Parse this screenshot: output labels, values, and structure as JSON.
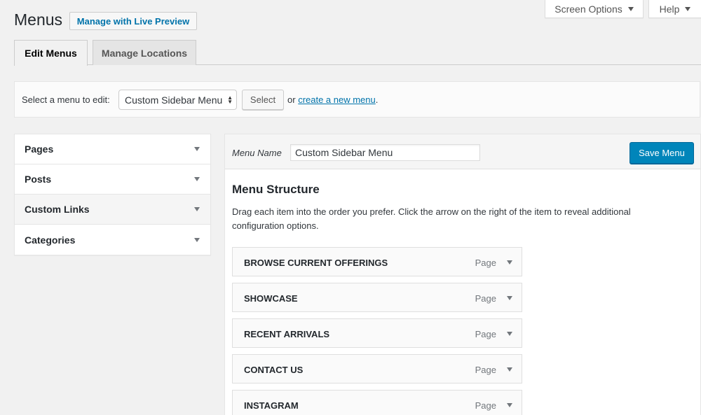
{
  "screen_meta": {
    "screen_options": "Screen Options",
    "help": "Help"
  },
  "header": {
    "title": "Menus",
    "live_preview": "Manage with Live Preview"
  },
  "tabs": [
    {
      "label": "Edit Menus",
      "active": true
    },
    {
      "label": "Manage Locations",
      "active": false
    }
  ],
  "menu_select": {
    "label": "Select a menu to edit:",
    "selected": "Custom Sidebar Menu",
    "select_button": "Select",
    "or_text": "or",
    "create_link": "create a new menu",
    "period": "."
  },
  "accordion": [
    {
      "label": "Pages"
    },
    {
      "label": "Posts"
    },
    {
      "label": "Custom Links"
    },
    {
      "label": "Categories"
    }
  ],
  "menu_editor": {
    "name_label": "Menu Name",
    "name_value": "Custom Sidebar Menu",
    "save_button": "Save Menu",
    "structure_title": "Menu Structure",
    "structure_desc": "Drag each item into the order you prefer. Click the arrow on the right of the item to reveal additional configuration options."
  },
  "menu_items": [
    {
      "title": "BROWSE CURRENT OFFERINGS",
      "type": "Page"
    },
    {
      "title": "SHOWCASE",
      "type": "Page"
    },
    {
      "title": "RECENT ARRIVALS",
      "type": "Page"
    },
    {
      "title": "CONTACT US",
      "type": "Page"
    },
    {
      "title": "INSTAGRAM",
      "type": "Page"
    }
  ],
  "colors": {
    "link": "#0073aa",
    "primary_button": "#0085ba",
    "background": "#f1f1f1"
  }
}
